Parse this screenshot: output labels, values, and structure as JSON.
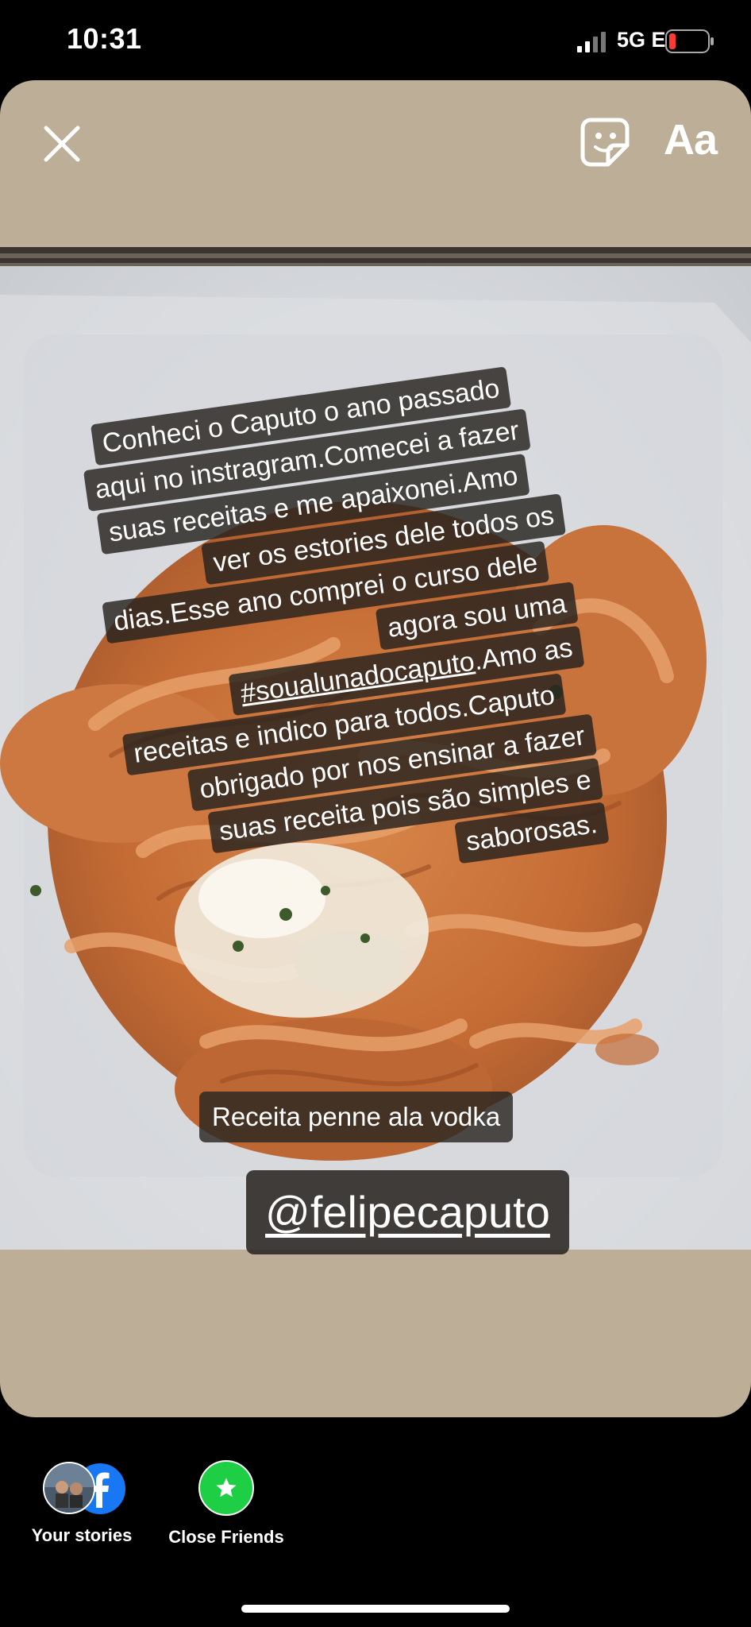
{
  "status_bar": {
    "time": "10:31",
    "network": "5G E",
    "icons": [
      "signal-icon",
      "battery-icon"
    ]
  },
  "story_editor": {
    "toolbar": {
      "close_icon": "close-icon",
      "sticker_icon": "sticker-icon",
      "text_tool_label": "Aa"
    },
    "caption": {
      "lines": [
        "Conheci o Caputo o ano passado",
        "aqui no instragram.Comecei a fazer",
        "suas receitas e me apaixonei.Amo",
        "ver os estories dele todos os",
        "dias.Esse ano comprei o curso dele",
        "agora sou uma",
        "receitas e indico para todos.Caputo",
        "obrigado por nos ensinar a fazer",
        "suas receita pois são simples e",
        "saborosas."
      ],
      "hashtag": "#soualunadocaputo",
      "hashtag_suffix": ".Amo as"
    },
    "recipe_label": "Receita penne ala vodka",
    "mention": "@felipecaputo"
  },
  "share_options": [
    {
      "label": "Your stories",
      "icon": "facebook-icon"
    },
    {
      "label": "Close Friends",
      "icon": "star-icon"
    }
  ],
  "colors": {
    "card_background": "#bcae97",
    "close_friends_green": "#1ecf45",
    "facebook_blue": "#1877f2"
  }
}
